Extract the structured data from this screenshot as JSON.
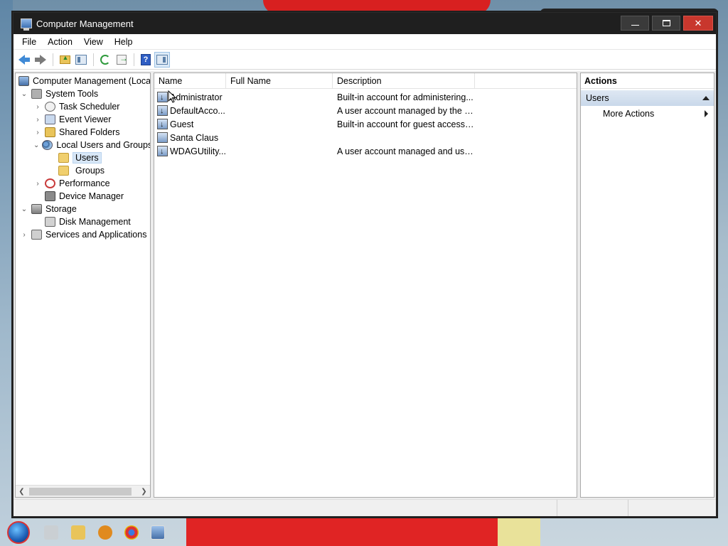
{
  "window": {
    "title": "Computer Management"
  },
  "menubar": {
    "items": [
      "File",
      "Action",
      "View",
      "Help"
    ]
  },
  "toolbar": {
    "buttons": [
      "back-icon",
      "forward-icon",
      "up-folder-icon",
      "show-hide-tree-icon",
      "refresh-icon",
      "export-list-icon",
      "help-icon",
      "show-hide-action-pane-icon"
    ]
  },
  "tree": {
    "root": "Computer Management (Local)",
    "system_tools": "System Tools",
    "task_scheduler": "Task Scheduler",
    "event_viewer": "Event Viewer",
    "shared_folders": "Shared Folders",
    "local_users_groups": "Local Users and Groups",
    "users": "Users",
    "groups": "Groups",
    "performance": "Performance",
    "device_manager": "Device Manager",
    "storage": "Storage",
    "disk_management": "Disk Management",
    "services_apps": "Services and Applications"
  },
  "list": {
    "columns": {
      "name": "Name",
      "full_name": "Full Name",
      "description": "Description"
    },
    "rows": [
      {
        "name": "Administrator",
        "full_name": "",
        "description": "Built-in account for administering...",
        "disabled": true
      },
      {
        "name": "DefaultAcco...",
        "full_name": "",
        "description": "A user account managed by the s...",
        "disabled": true
      },
      {
        "name": "Guest",
        "full_name": "",
        "description": "Built-in account for guest access t...",
        "disabled": true
      },
      {
        "name": "Santa Claus",
        "full_name": "",
        "description": "",
        "disabled": false
      },
      {
        "name": "WDAGUtility...",
        "full_name": "",
        "description": "A user account managed and use...",
        "disabled": true
      }
    ]
  },
  "actions": {
    "title": "Actions",
    "section": "Users",
    "more_actions": "More Actions"
  },
  "colors": {
    "titlebar": "#1f1f1f",
    "close_button": "#c8372d",
    "selection": "#d8e7f7",
    "actions_section": "#c9d8ea"
  }
}
